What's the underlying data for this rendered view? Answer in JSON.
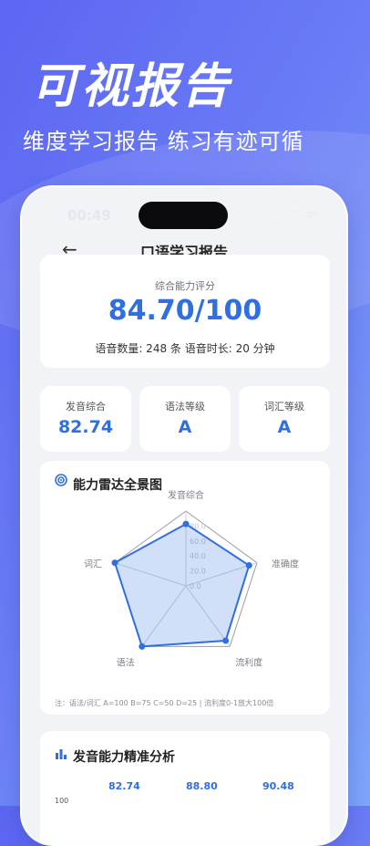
{
  "hero": {
    "title": "可视报告",
    "subtitle": "维度学习报告 练习有迹可循"
  },
  "status_bar": {
    "time": "00:49",
    "icons": "··· ⌔ ▭"
  },
  "nav": {
    "back_icon": "←",
    "title": "口语学习报告"
  },
  "score": {
    "label": "综合能力评分",
    "value": "84.70/100",
    "meta": "语音数量: 248 条   语音时长: 20 分钟"
  },
  "stats": [
    {
      "label": "发音综合",
      "value": "82.74"
    },
    {
      "label": "语法等级",
      "value": "A"
    },
    {
      "label": "词汇等级",
      "value": "A"
    }
  ],
  "radar": {
    "title": "能力雷达全景图",
    "icon": "target-icon",
    "note": "注：语法/词汇 A=100 B=75 C=50 D=25 | 流利度0-1放大100倍"
  },
  "chart_data": {
    "type": "radar",
    "title": "能力雷达全景图",
    "axes": [
      "发音综合",
      "准确度",
      "流利度",
      "语法",
      "词汇"
    ],
    "ticks": [
      "0.0",
      "20.0",
      "40.0",
      "60.0",
      "80.0"
    ],
    "range": [
      0,
      100
    ],
    "values": [
      82.74,
      88.8,
      90.48,
      100,
      100
    ],
    "color": "#2f6fe0",
    "fill": "rgba(47,111,224,0.22)"
  },
  "bars": {
    "title": "发音能力精准分析",
    "icon": "bar-chart-icon",
    "values": [
      "82.74",
      "88.80",
      "90.48"
    ],
    "axis_top": "100"
  }
}
